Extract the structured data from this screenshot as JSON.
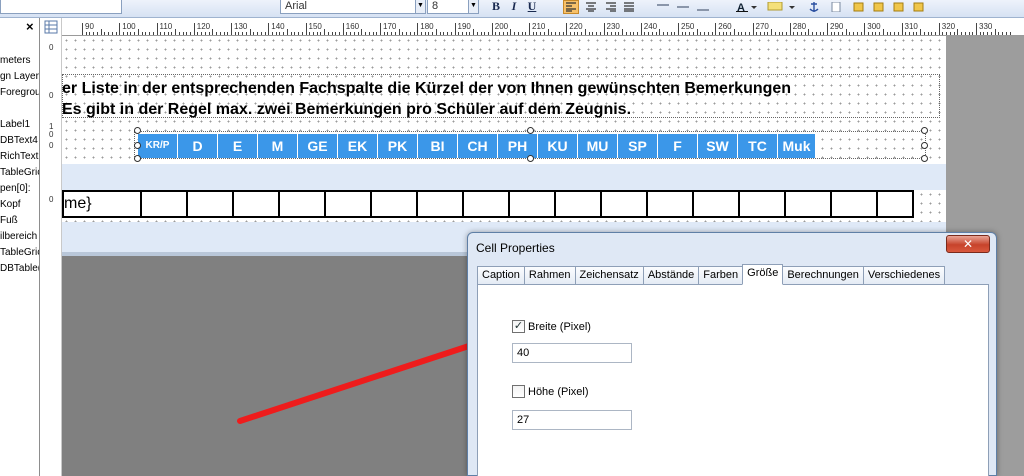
{
  "toolbar": {
    "font_name": "Arial",
    "font_size": "8",
    "bold": "B",
    "italic": "I",
    "underline": "U"
  },
  "tree": {
    "close": "×",
    "items": [
      "meters",
      "gn Layer",
      "Foregrou",
      "",
      "Label1",
      "DBText4",
      "RichText",
      "TableGric",
      "pen[0]:",
      "Kopf",
      "Fuß",
      "ilbereich",
      "TableGric",
      "DBTable("
    ]
  },
  "ruler": {
    "h_labels": [
      "90",
      "100",
      "110",
      "120",
      "130",
      "140",
      "150",
      "160",
      "170",
      "180",
      "190",
      "200",
      "210",
      "220",
      "230",
      "240",
      "250",
      "260",
      "270",
      "280",
      "290",
      "300",
      "310",
      "320",
      "330"
    ],
    "v_labels": [
      "0",
      "0",
      "1\n0",
      "0",
      "0"
    ]
  },
  "report": {
    "line1": "er Liste in der entsprechenden Fachspalte die Kürzel der von Ihnen gewünschten Bemerkungen",
    "line2": "Es gibt in der Regel max. zwei Bemerkungen pro Schüler auf dem Zeugnis.",
    "subjects": [
      "KR/P",
      "D",
      "E",
      "M",
      "GE",
      "EK",
      "PK",
      "BI",
      "CH",
      "PH",
      "KU",
      "MU",
      "SP",
      "F",
      "SW",
      "TC",
      "Muk"
    ],
    "first_cell": "me}"
  },
  "dialog": {
    "title": "Cell Properties",
    "close_symbol": "✕",
    "tabs": [
      "Caption",
      "Rahmen",
      "Zeichensatz",
      "Abstände",
      "Farben",
      "Größe",
      "Berechnungen",
      "Verschiedenes"
    ],
    "active_tab": "Größe",
    "width_label": "Breite (Pixel)",
    "width_checked": true,
    "width_value": "40",
    "height_label": "Höhe (Pixel)",
    "height_checked": false,
    "height_value": "27"
  },
  "colors": {
    "subject_bg": "#3b97e9",
    "annotation_arrow": "#ee1c1c"
  }
}
